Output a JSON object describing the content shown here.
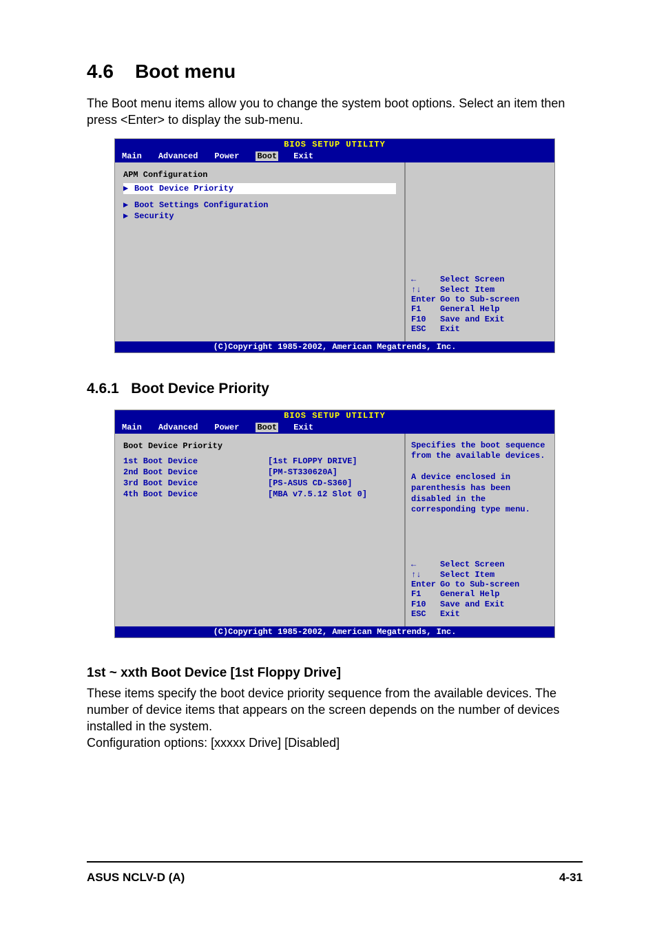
{
  "heading": {
    "number": "4.6",
    "title": "Boot menu"
  },
  "intro": "The Boot menu items allow you to change the system boot options. Select an item then press <Enter> to display the sub-menu.",
  "bios1": {
    "title": "BIOS SETUP UTILITY",
    "tabs": [
      "Main",
      "Advanced",
      "Power",
      "Boot",
      "Exit"
    ],
    "active_tab": "Boot",
    "apm": "APM Configuration",
    "items": [
      {
        "label": "Boot Device Priority",
        "selected": true
      },
      {
        "label": "Boot Settings Configuration",
        "selected": false
      },
      {
        "label": "Security",
        "selected": false
      }
    ],
    "help_top": "",
    "nav": [
      {
        "key": "←",
        "desc": "Select Screen"
      },
      {
        "key": "↑↓",
        "desc": "Select Item"
      },
      {
        "key": "Enter",
        "desc": "Go to Sub-screen"
      },
      {
        "key": "F1",
        "desc": "General Help"
      },
      {
        "key": "F10",
        "desc": "Save and Exit"
      },
      {
        "key": "ESC",
        "desc": "Exit"
      }
    ],
    "footer": "(C)Copyright 1985-2002, American Megatrends, Inc."
  },
  "subheading": {
    "number": "4.6.1",
    "title": "Boot Device Priority"
  },
  "bios2": {
    "title": "BIOS SETUP UTILITY",
    "tabs": [
      "Main",
      "Advanced",
      "Power",
      "Boot",
      "Exit"
    ],
    "active_tab": "Boot",
    "header": "Boot Device Priority",
    "devices": [
      {
        "name": "1st Boot Device",
        "value": "[1st FLOPPY DRIVE]"
      },
      {
        "name": "2nd Boot Device",
        "value": "[PM-ST330620A]"
      },
      {
        "name": "3rd Boot Device",
        "value": "[PS-ASUS CD-S360]"
      },
      {
        "name": "4th Boot Device",
        "value": "[MBA v7.5.12 Slot 0]"
      }
    ],
    "help_top": "Specifies the boot sequence from the available devices.\n\nA device enclosed in parenthesis has been disabled in the corresponding type menu.",
    "nav": [
      {
        "key": "←",
        "desc": "Select Screen"
      },
      {
        "key": "↑↓",
        "desc": "Select Item"
      },
      {
        "key": "Enter",
        "desc": "Go to Sub-screen"
      },
      {
        "key": "F1",
        "desc": "General Help"
      },
      {
        "key": "F10",
        "desc": "Save and Exit"
      },
      {
        "key": "ESC",
        "desc": "Exit"
      }
    ],
    "footer": "(C)Copyright 1985-2002, American Megatrends, Inc."
  },
  "sub_sub_heading": "1st ~ xxth Boot Device [1st Floppy Drive]",
  "body1": "These items specify the boot device priority sequence from the available devices. The number of device items that appears on the screen depends on the number of devices installed in the system.",
  "body2": "Configuration options: [xxxxx Drive] [Disabled]",
  "page_footer_left": "ASUS NCLV-D (A)",
  "page_footer_right": "4-31"
}
